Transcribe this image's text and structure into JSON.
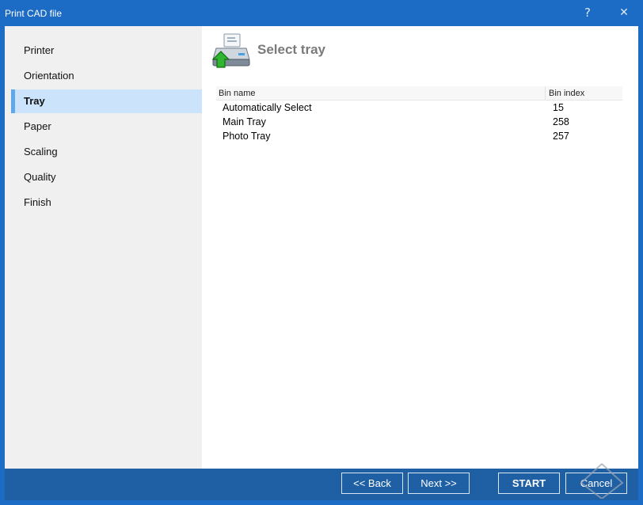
{
  "window": {
    "title": "Print CAD file",
    "help_glyph": "?",
    "close_glyph": "✕"
  },
  "sidebar": {
    "items": [
      {
        "label": "Printer"
      },
      {
        "label": "Orientation"
      },
      {
        "label": "Tray",
        "selected": true
      },
      {
        "label": "Paper"
      },
      {
        "label": "Scaling"
      },
      {
        "label": "Quality"
      },
      {
        "label": "Finish"
      }
    ]
  },
  "main": {
    "title": "Select tray",
    "icon": "printer-tray-icon",
    "table": {
      "headers": {
        "name": "Bin name",
        "index": "Bin index"
      },
      "rows": [
        {
          "name": "Automatically Select",
          "index": "15"
        },
        {
          "name": "Main Tray",
          "index": "258"
        },
        {
          "name": "Photo Tray",
          "index": "257"
        }
      ]
    }
  },
  "footer": {
    "back_label": "<< Back",
    "next_label": "Next >>",
    "start_label": "START",
    "cancel_label": "Cancel"
  },
  "colors": {
    "title_bar": "#1c6bc4",
    "bottom_bar": "#1f5fa3",
    "sidebar_bg": "#f0f0f0",
    "selected_bg": "#cce4fb",
    "selected_accent": "#5fa8ea"
  }
}
